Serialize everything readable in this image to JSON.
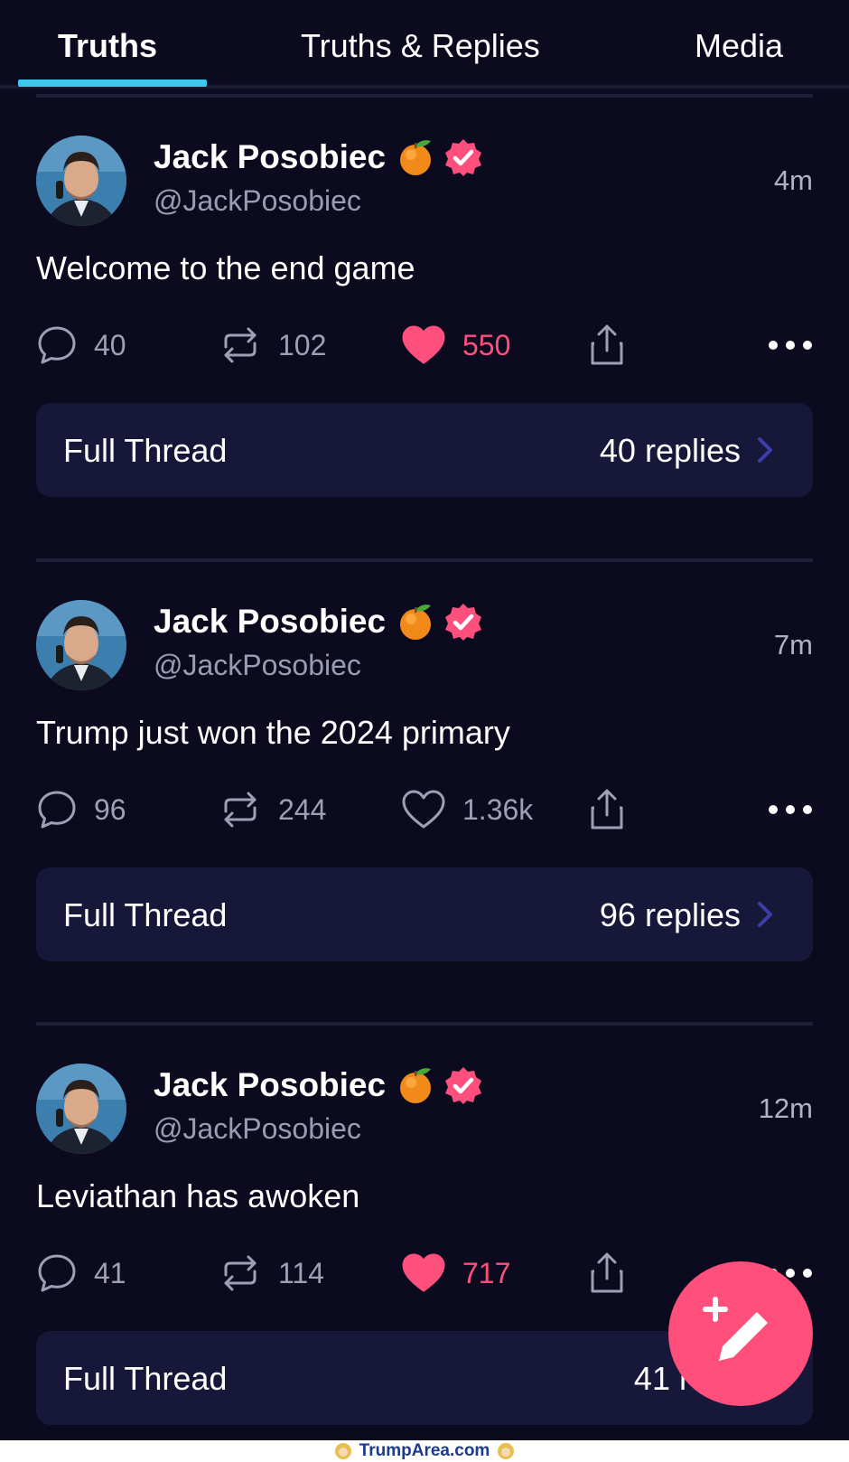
{
  "tabs": [
    {
      "label": "Truths",
      "active": true
    },
    {
      "label": "Truths & Replies",
      "active": false
    },
    {
      "label": "Media",
      "active": false
    }
  ],
  "colors": {
    "background": "#0b0a1e",
    "tab_underline": "#3fc7ee",
    "like_active": "#ff4f7d",
    "thread_bg": "#17173a",
    "fab": "#ff4f7a",
    "verified": "#ff4f7d"
  },
  "posts": [
    {
      "author": "Jack Posobiec",
      "handle": "@JackPosobiec",
      "time": "4m",
      "text": "Welcome to the end game",
      "replies": "40",
      "retruths": "102",
      "likes": "550",
      "liked": true,
      "thread_label": "Full Thread",
      "thread_count": "40 replies"
    },
    {
      "author": "Jack Posobiec",
      "handle": "@JackPosobiec",
      "time": "7m",
      "text": "Trump just won the 2024 primary",
      "replies": "96",
      "retruths": "244",
      "likes": "1.36k",
      "liked": false,
      "thread_label": "Full Thread",
      "thread_count": "96 replies"
    },
    {
      "author": "Jack Posobiec",
      "handle": "@JackPosobiec",
      "time": "12m",
      "text": "Leviathan has awoken",
      "replies": "41",
      "retruths": "114",
      "likes": "717",
      "liked": true,
      "thread_label": "Full Thread",
      "thread_count": "41 repli"
    }
  ],
  "icons": {
    "reply": "speech-bubble-icon",
    "retruth": "repost-arrows-icon",
    "like": "heart-icon",
    "share": "share-upload-icon",
    "more": "ellipsis-icon",
    "verified": "verified-badge-icon",
    "emoji": "tangerine-emoji",
    "compose": "compose-pencil-plus-icon"
  },
  "watermark": {
    "text": "TrumpArea.com"
  }
}
